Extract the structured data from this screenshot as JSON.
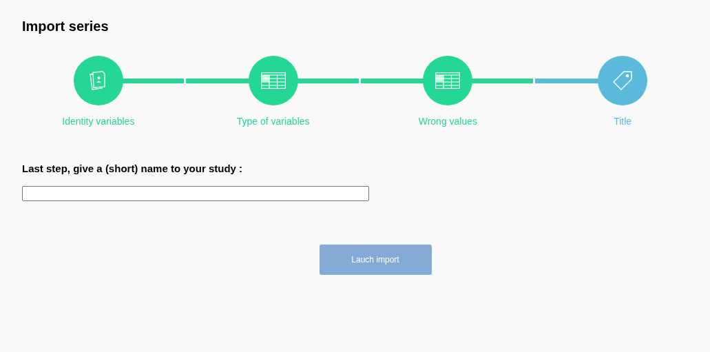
{
  "title": "Import series",
  "steps": [
    {
      "label": "Identity variables",
      "selected": false
    },
    {
      "label": "Type of variables",
      "selected": false
    },
    {
      "label": "Wrong values",
      "selected": false
    },
    {
      "label": "Title",
      "selected": true
    }
  ],
  "prompt": "Last step, give a (short) name to your study :",
  "button": {
    "label": "Lauch import",
    "disabled": true
  }
}
